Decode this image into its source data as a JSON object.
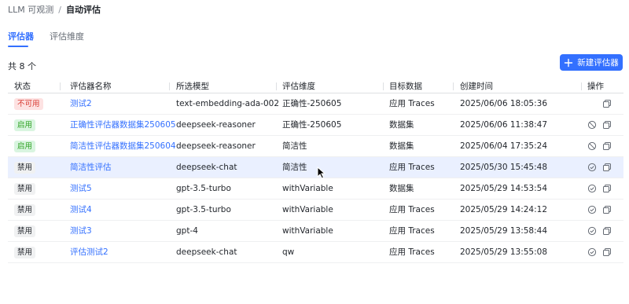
{
  "breadcrumb": {
    "root": "LLM 可观测",
    "separator": "/",
    "current": "自动评估"
  },
  "tabs": [
    {
      "label": "评估器",
      "active": true
    },
    {
      "label": "评估维度",
      "active": false
    }
  ],
  "summary": {
    "total_label": "共 8 个"
  },
  "new_button": {
    "label": "新建评估器",
    "icon": "plus-icon"
  },
  "table": {
    "columns": [
      "状态",
      "评估器名称",
      "所选模型",
      "评估维度",
      "目标数据",
      "创建时间",
      "操作"
    ],
    "rows": [
      {
        "status": "不可用",
        "status_type": "unavailable",
        "name": "测试2",
        "model": "text-embedding-ada-002",
        "dimension": "正确性-250605",
        "target": "应用 Traces",
        "created": "2025/06/06  18:05:36",
        "actions": [
          "copy-icon"
        ]
      },
      {
        "status": "启用",
        "status_type": "enabled",
        "name": "正确性评估器数据集250605",
        "model": "deepseek-reasoner",
        "dimension": "正确性-250605",
        "target": "数据集",
        "created": "2025/06/06  11:38:47",
        "actions": [
          "disable-icon",
          "copy-icon"
        ]
      },
      {
        "status": "启用",
        "status_type": "enabled",
        "name": "简洁性评估器数据集250604",
        "model": "deepseek-reasoner",
        "dimension": "简洁性",
        "target": "数据集",
        "created": "2025/06/04  17:35:24",
        "actions": [
          "disable-icon",
          "copy-icon"
        ]
      },
      {
        "status": "禁用",
        "status_type": "disabled",
        "name": "简洁性评估",
        "model": "deepseek-chat",
        "dimension": "简洁性",
        "target": "应用 Traces",
        "created": "2025/05/30  15:45:48",
        "actions": [
          "enable-icon",
          "copy-icon"
        ]
      },
      {
        "status": "禁用",
        "status_type": "disabled",
        "name": "测试5",
        "model": "gpt-3.5-turbo",
        "dimension": "withVariable",
        "target": "数据集",
        "created": "2025/05/29  14:53:54",
        "actions": [
          "enable-icon",
          "copy-icon"
        ]
      },
      {
        "status": "禁用",
        "status_type": "disabled",
        "name": "测试4",
        "model": "gpt-3.5-turbo",
        "dimension": "withVariable",
        "target": "应用 Traces",
        "created": "2025/05/29  14:24:12",
        "actions": [
          "enable-icon",
          "copy-icon"
        ]
      },
      {
        "status": "禁用",
        "status_type": "disabled",
        "name": "测试3",
        "model": "gpt-4",
        "dimension": "withVariable",
        "target": "应用 Traces",
        "created": "2025/05/29  13:58:44",
        "actions": [
          "enable-icon",
          "copy-icon"
        ]
      },
      {
        "status": "禁用",
        "status_type": "disabled",
        "name": "评估测试2",
        "model": "deepseek-chat",
        "dimension": "qw",
        "target": "应用 Traces",
        "created": "2025/05/29  13:55:08",
        "actions": [
          "enable-icon",
          "copy-icon"
        ]
      }
    ]
  },
  "colors": {
    "accent": "#3370ff",
    "enabled": "#2ea121",
    "unavailable": "#d83931",
    "hover_row": "#eaf0ff"
  }
}
